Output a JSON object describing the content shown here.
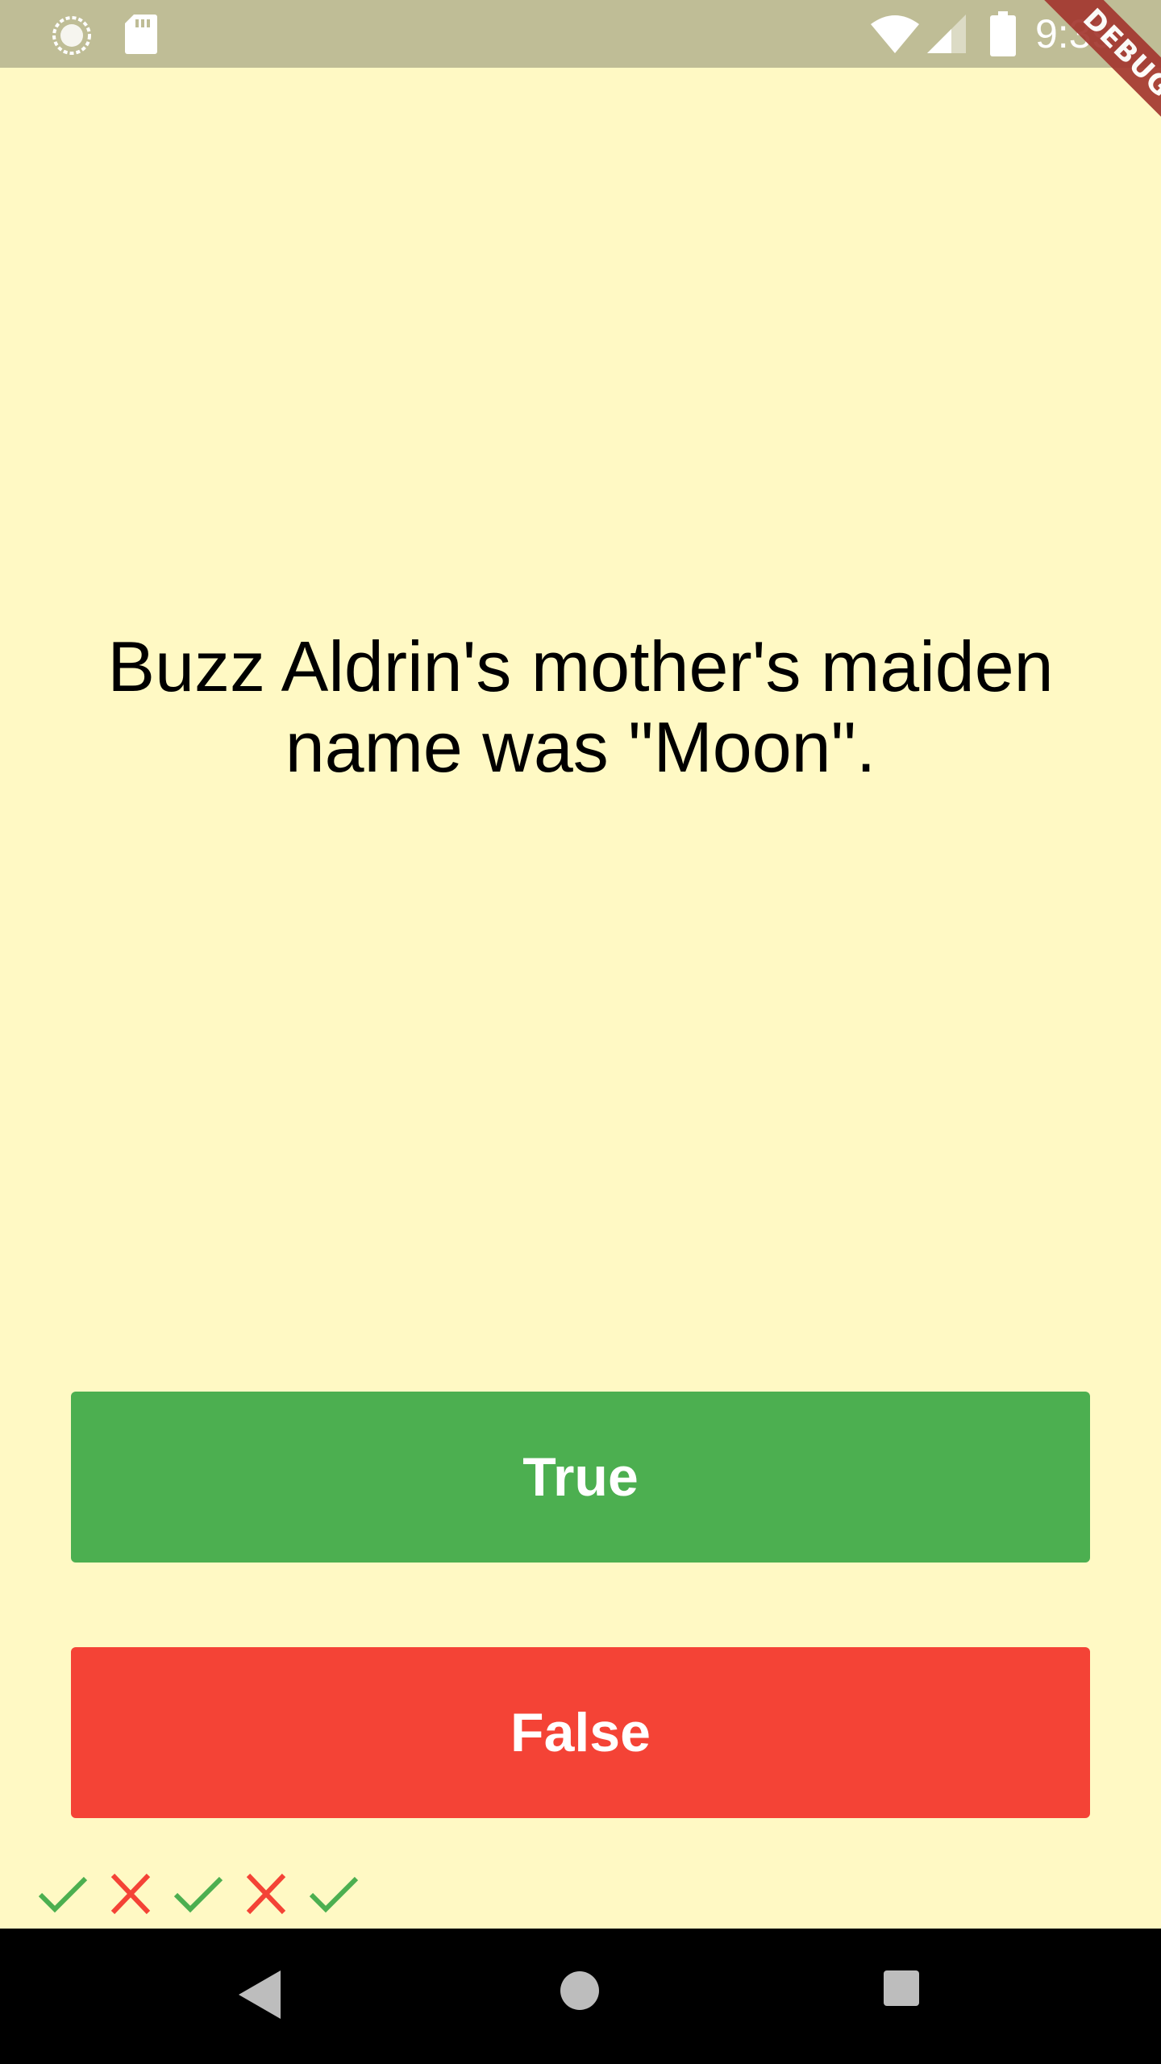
{
  "status_bar": {
    "time": "9:39",
    "icons": [
      "sync-icon",
      "sd-card-icon",
      "wifi-icon",
      "cell-signal-icon",
      "battery-icon"
    ]
  },
  "debug_banner": {
    "label": "DEBUG"
  },
  "question": {
    "text": "Buzz Aldrin's mother's maiden name was \"Moon\"."
  },
  "buttons": {
    "true_label": "True",
    "false_label": "False",
    "true_color": "#4caf50",
    "false_color": "#f44336"
  },
  "score_keeper": {
    "results": [
      "correct",
      "wrong",
      "correct",
      "wrong",
      "correct"
    ],
    "correct_icon": "check-icon",
    "wrong_icon": "close-icon",
    "correct_color": "#4caf50",
    "wrong_color": "#f44336"
  },
  "navigation": {
    "buttons": [
      "back-icon",
      "home-icon",
      "recents-icon"
    ]
  },
  "colors": {
    "background": "#fff9c4",
    "status_bar": "#bfbd96",
    "nav_bar": "#000000"
  }
}
